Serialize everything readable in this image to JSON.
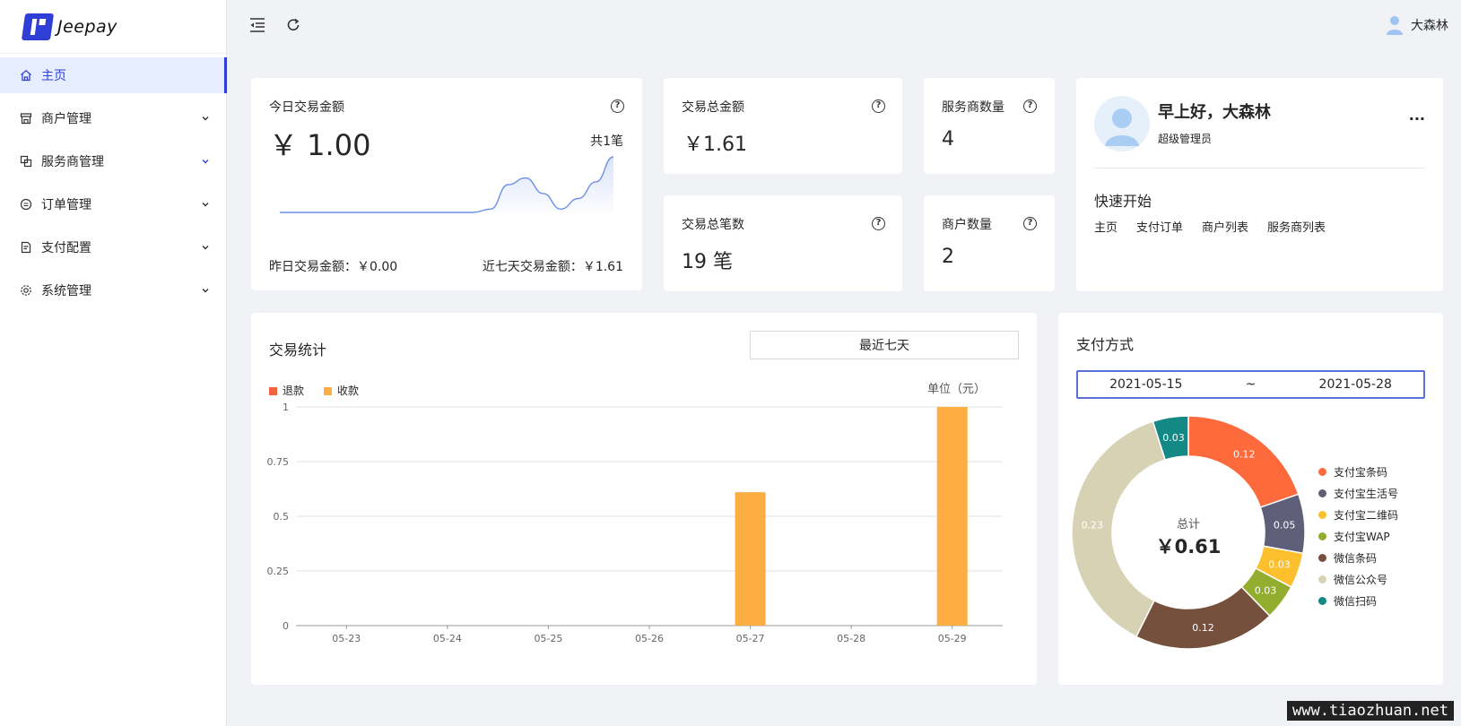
{
  "brand": {
    "name": "Jeepay"
  },
  "header": {
    "user_name": "大森林"
  },
  "sidebar": {
    "items": [
      {
        "label": "主页",
        "active": true,
        "icon": "home-icon"
      },
      {
        "label": "商户管理",
        "icon": "shop-icon"
      },
      {
        "label": "服务商管理",
        "icon": "block-icon"
      },
      {
        "label": "订单管理",
        "icon": "transaction-icon"
      },
      {
        "label": "支付配置",
        "icon": "file-icon"
      },
      {
        "label": "系统管理",
        "icon": "setting-icon"
      }
    ]
  },
  "today": {
    "title": "今日交易金额",
    "amount": "￥ 1.00",
    "count": "共1笔",
    "yesterday": "昨日交易金额：￥0.00",
    "week": "近七天交易金额：￥1.61"
  },
  "total_amount": {
    "title": "交易总金额",
    "value": "￥1.61"
  },
  "total_count": {
    "title": "交易总笔数",
    "value": "19 笔"
  },
  "isv_count": {
    "title": "服务商数量",
    "value": "4"
  },
  "mch_count": {
    "title": "商户数量",
    "value": "2"
  },
  "welcome": {
    "greeting": "早上好，大森林",
    "role": "超级管理员",
    "more": "···",
    "quick_title": "快速开始",
    "links": [
      "主页",
      "支付订单",
      "商户列表",
      "服务商列表"
    ]
  },
  "trade_stats": {
    "title": "交易统计",
    "range_select": "最近七天",
    "unit": "单位（元）",
    "legend": [
      "退款",
      "收款"
    ]
  },
  "pay_type": {
    "title": "支付方式",
    "date_start": "2021-05-15",
    "date_sep": "~",
    "date_end": "2021-05-28",
    "center_label": "总计",
    "center_value": "￥0.61",
    "legend": [
      "支付宝条码",
      "支付宝生活号",
      "支付宝二维码",
      "支付宝WAP",
      "微信条码",
      "微信公众号",
      "微信扫码"
    ]
  },
  "watermark": "www.tiaozhuan.net",
  "chart_data": [
    {
      "type": "bar",
      "categories": [
        "05-23",
        "05-24",
        "05-25",
        "05-26",
        "05-27",
        "05-28",
        "05-29"
      ],
      "series": [
        {
          "name": "退款",
          "values": [
            0,
            0,
            0,
            0,
            0,
            0,
            0
          ],
          "color": "#f4633f"
        },
        {
          "name": "收款",
          "values": [
            0,
            0,
            0,
            0,
            0.61,
            0,
            1
          ],
          "color": "#fdae43"
        }
      ],
      "title": "交易统计",
      "ylabel": "单位（元）",
      "yticks": [
        "0",
        "0.25",
        "0.5",
        "0.75",
        "1"
      ],
      "ylim": [
        0,
        1
      ],
      "grid": true,
      "legend_position": "top-left"
    },
    {
      "type": "pie",
      "title": "支付方式",
      "donut": true,
      "slices": [
        {
          "name": "支付宝条码",
          "value": 0.12,
          "color": "#ff6a3d"
        },
        {
          "name": "支付宝生活号",
          "value": 0.05,
          "color": "#5f5f7a"
        },
        {
          "name": "支付宝二维码",
          "value": 0.03,
          "color": "#fcbf2d"
        },
        {
          "name": "支付宝WAP",
          "value": 0.03,
          "color": "#93ad2f"
        },
        {
          "name": "微信条码",
          "value": 0.12,
          "color": "#74503d"
        },
        {
          "name": "微信公众号",
          "value": 0.23,
          "color": "#d7d2b3"
        },
        {
          "name": "微信扫码",
          "value": 0.03,
          "color": "#138985"
        }
      ],
      "legend_position": "right"
    },
    {
      "type": "area",
      "title": "",
      "x_count": 20,
      "values": [
        0,
        0,
        0,
        0,
        0,
        0,
        0,
        0,
        0,
        0,
        0,
        0,
        0.06,
        0.5,
        0.62,
        0.34,
        0.06,
        0.25,
        0.55,
        1.0
      ],
      "color": "#6e8fe8"
    }
  ]
}
